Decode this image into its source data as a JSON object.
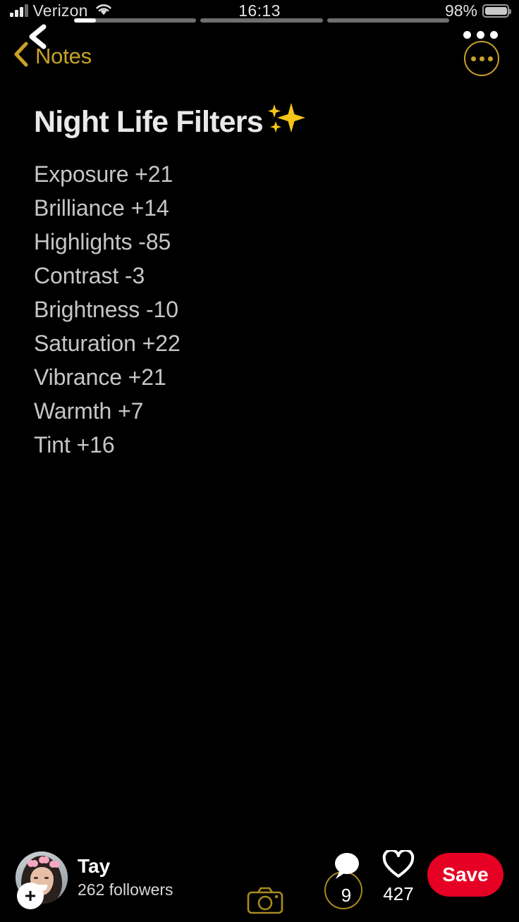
{
  "status_bar": {
    "carrier": "Verizon",
    "time": "16:13",
    "battery_percent": "98%",
    "signal_icon": "signal-bars-icon",
    "wifi_icon": "wifi-icon",
    "battery_icon": "battery-icon"
  },
  "story": {
    "segments": [
      {
        "fill_percent": 18
      },
      {
        "fill_percent": 0
      },
      {
        "fill_percent": 0
      }
    ],
    "back_icon": "chevron-left-icon",
    "menu_icon": "more-horizontal-icon"
  },
  "notes_nav": {
    "back_label": "Notes",
    "back_icon": "chevron-left-icon",
    "more_icon": "more-circle-icon",
    "accent_color": "#c9a227"
  },
  "note": {
    "title": "Night Life Filters",
    "title_emoji": "sparkles-emoji",
    "filters": [
      {
        "label": "Exposure",
        "value": "+21",
        "text": "Exposure +21"
      },
      {
        "label": "Brilliance",
        "value": "+14",
        "text": "Brilliance +14"
      },
      {
        "label": "Highlights",
        "value": "-85",
        "text": "Highlights -85"
      },
      {
        "label": "Contrast",
        "value": "-3",
        "text": "Contrast -3"
      },
      {
        "label": "Brightness",
        "value": "-10",
        "text": "Brightness -10"
      },
      {
        "label": "Saturation",
        "value": "+22",
        "text": "Saturation +22"
      },
      {
        "label": "Vibrance",
        "value": "+21",
        "text": "Vibrance +21"
      },
      {
        "label": "Warmth",
        "value": "+7",
        "text": "Warmth +7"
      },
      {
        "label": "Tint",
        "value": "+16",
        "text": "Tint +16"
      }
    ]
  },
  "bottom_bar": {
    "creator_name": "Tay",
    "followers": "262 followers",
    "avatar_icon": "avatar",
    "follow_plus_icon": "plus-icon",
    "camera_icon": "camera-icon",
    "comment": {
      "icon": "comment-bubble-icon",
      "count": "9"
    },
    "like": {
      "icon": "heart-icon",
      "count": "427"
    },
    "save_label": "Save",
    "save_color": "#e60023"
  }
}
